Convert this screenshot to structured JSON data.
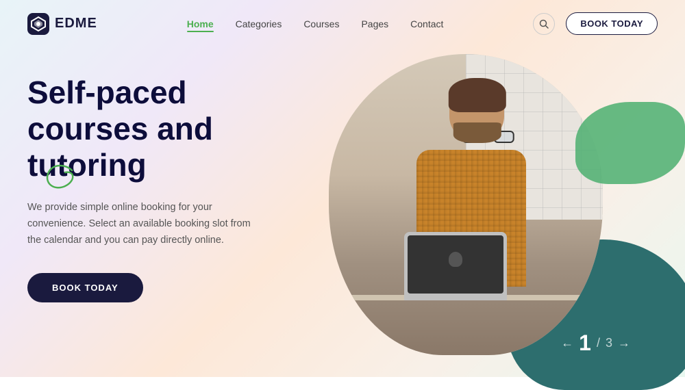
{
  "logo": {
    "text": "EDME"
  },
  "nav": {
    "items": [
      {
        "label": "Home",
        "active": true
      },
      {
        "label": "Categories",
        "active": false
      },
      {
        "label": "Courses",
        "active": false
      },
      {
        "label": "Pages",
        "active": false
      },
      {
        "label": "Contact",
        "active": false
      }
    ],
    "book_today_label": "BOOK TODAY"
  },
  "hero": {
    "title": "Self-paced courses and tutoring",
    "description": "We provide simple online booking for your convenience. Select an available booking slot from the calendar and you can pay directly online.",
    "book_today_label": "BOOK TODAY"
  },
  "pagination": {
    "current": "1",
    "total": "3",
    "prev_arrow": "←",
    "next_arrow": "→",
    "separator": "/"
  }
}
